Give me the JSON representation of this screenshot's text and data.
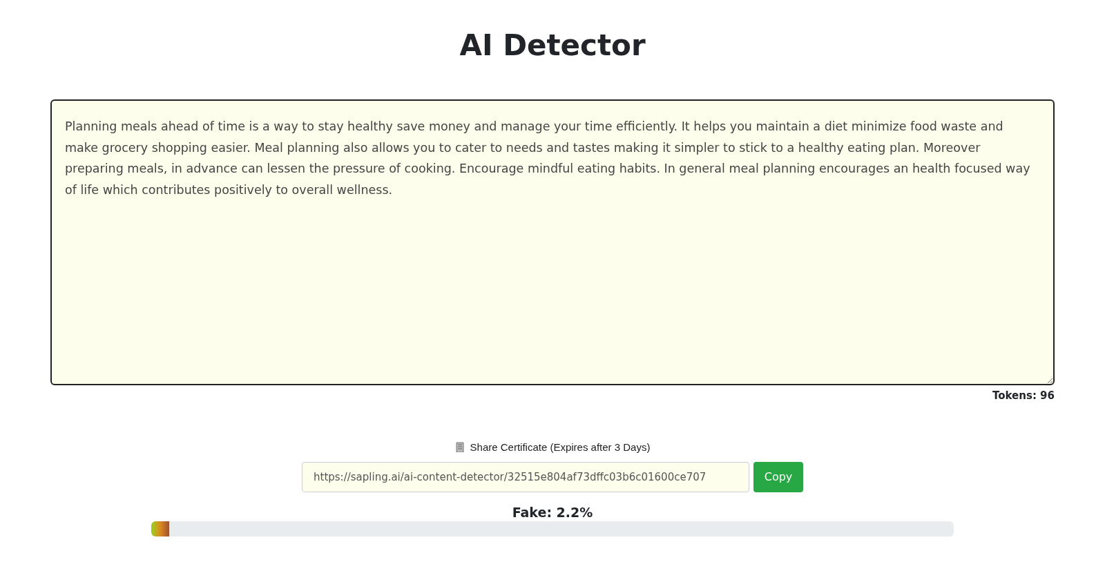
{
  "title": "AI Detector",
  "input_text": "Planning meals ahead of time is a way to stay healthy save money and manage your time efficiently. It helps you maintain a diet minimize food waste and make grocery shopping easier. Meal planning also allows you to cater to needs and tastes making it simpler to stick to a healthy eating plan. Moreover preparing meals, in advance can lessen the pressure of cooking. Encourage mindful eating habits. In general meal planning encourages an health focused way of life which contributes positively to overall wellness.",
  "tokens": "Tokens: 96",
  "share": {
    "label": "Share Certificate (Expires after 3 Days)",
    "url": "https://sapling.ai/ai-content-detector/32515e804af73dffc03b6c01600ce707",
    "button": "Copy"
  },
  "result": {
    "label": "Fake: 2.2%",
    "level": 0.022
  }
}
